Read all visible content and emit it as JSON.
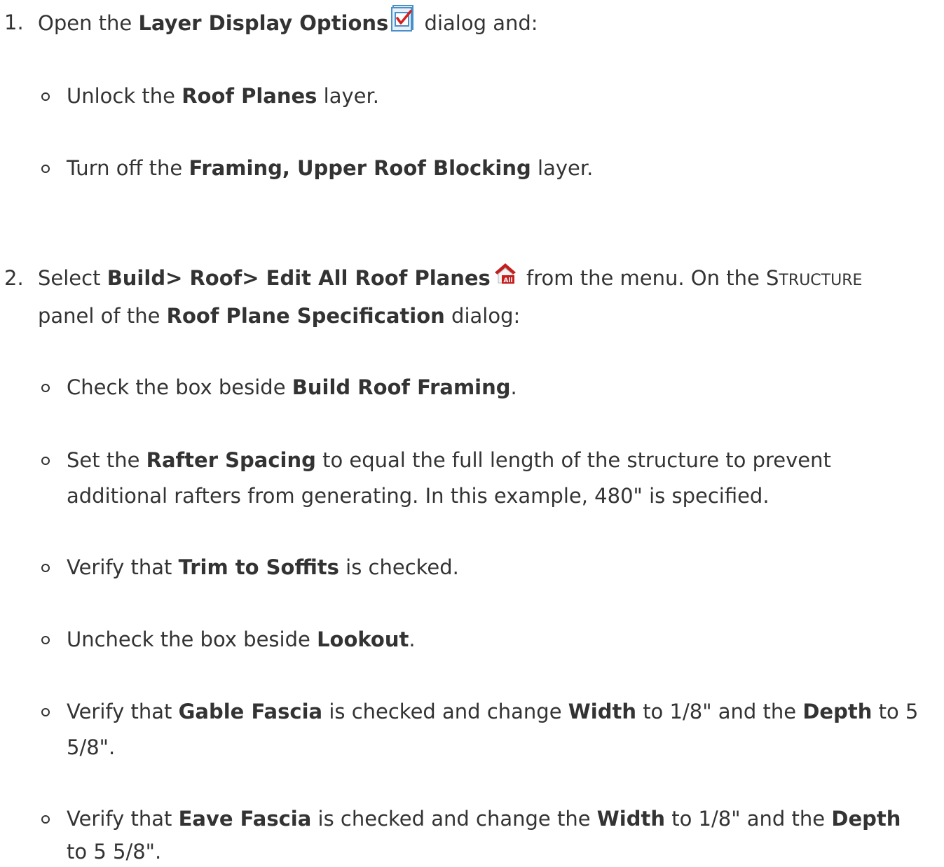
{
  "step1": {
    "number": "1.",
    "prefix": "Open the",
    "dialog": "Layer Display Options",
    "icon": "layer-display-options-icon",
    "suffix": "dialog and:",
    "bullets": [
      {
        "pre": "Unlock the",
        "bold": "Roof Planes",
        "post": "layer."
      },
      {
        "pre": "Turn off the",
        "bold": "Framing, Upper Roof Blocking",
        "post": "layer."
      }
    ]
  },
  "step2": {
    "number": "2.",
    "prefix": "Select",
    "menu_path": "Build> Roof> Edit All Roof Planes",
    "icon": "edit-all-roof-planes-icon",
    "mid": "from the menu. On the",
    "panel_first": "S",
    "panel_rest": "TRUCTURE",
    "line2_pre": "panel of the",
    "dialog": "Roof Plane Specification",
    "line2_post": "dialog:",
    "bullets": [
      {
        "pre": "Check the box beside",
        "bold": "Build Roof Framing",
        "post": "."
      },
      {
        "pre": "Set the",
        "bold": "Rafter Spacing",
        "post": "to equal the full length of the structure to prevent",
        "line2": "additional rafters from generating. In this example, 480\" is specified."
      },
      {
        "pre": "Verify that",
        "bold": "Trim to Soffits",
        "post": "is checked."
      },
      {
        "pre": "Uncheck the box beside",
        "bold": "Lookout",
        "post": "."
      },
      {
        "pre": "Verify that",
        "bold": "Gable Fascia",
        "post": "is checked and change",
        "bold2": "Width",
        "post2": "to 1/8\" and the",
        "bold3": "Depth",
        "post3": "to 5",
        "line2": "5/8\"."
      },
      {
        "pre": "Verify that",
        "bold": "Eave Fascia",
        "post": "is checked and change the",
        "bold2": "Width",
        "post2": "to 1/8\" and the",
        "bold3": "Depth",
        "line2": "to 5 5/8\"."
      }
    ]
  },
  "colors": {
    "text": "#333333",
    "checkbox_blue": "#4a90c8",
    "check_red": "#d42020",
    "roof_red": "#c41e1e"
  }
}
